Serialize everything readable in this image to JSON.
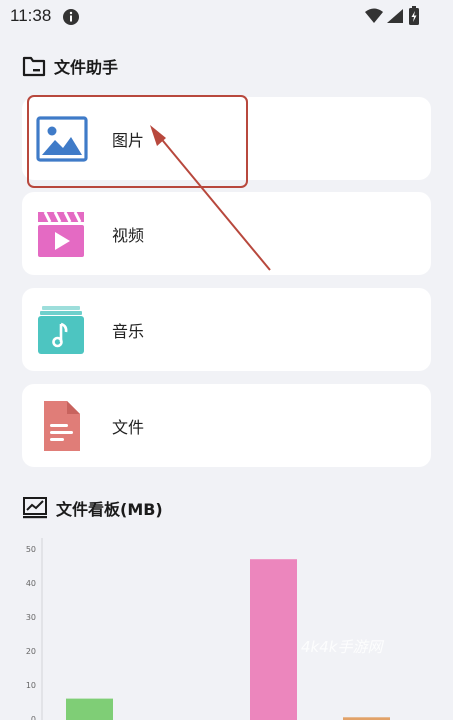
{
  "status_bar": {
    "time": "11:38"
  },
  "files_section": {
    "title": "文件助手",
    "items": [
      {
        "label": "图片",
        "icon": "image-icon",
        "color": "#3f7bc8"
      },
      {
        "label": "视频",
        "icon": "video-icon",
        "color": "#e46ac3"
      },
      {
        "label": "音乐",
        "icon": "music-icon",
        "color": "#4dc5c1"
      },
      {
        "label": "文件",
        "icon": "document-icon",
        "color": "#e07d78"
      }
    ]
  },
  "board_section": {
    "title": "文件看板(MB)"
  },
  "chart_data": {
    "type": "bar",
    "categories": [
      "",
      "",
      "",
      ""
    ],
    "series": [
      {
        "values": [
          6,
          0,
          47,
          0.5
        ]
      }
    ],
    "colors": [
      "#7fce76",
      "#7fce76",
      "#ec86bd",
      "#e2a268"
    ],
    "yticks": [
      "50",
      "40",
      "30",
      "20",
      "10",
      "0"
    ],
    "ylim": [
      0,
      50
    ],
    "grid": false
  },
  "watermark": "4k4k手游网"
}
